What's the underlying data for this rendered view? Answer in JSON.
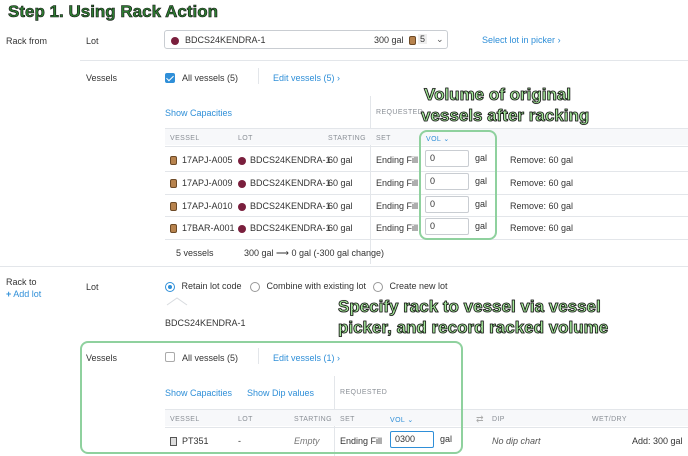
{
  "step_title": "Step 1.  Using Rack Action",
  "annotations": {
    "volume_line1": "Volume of original",
    "volume_line2": "vessels after racking",
    "specify_line1": "Specify rack to vessel via vessel",
    "specify_line2": "picker, and record racked volume"
  },
  "rack_from": {
    "label": "Rack from",
    "lot_label": "Lot",
    "lot_value": "BDCS24KENDRA-1",
    "lot_volume": "300 gal",
    "lot_count": "5",
    "select_lot_link": "Select lot in picker",
    "vessels_label": "Vessels",
    "all_vessels_label": "All vessels (5)",
    "edit_vessels_link": "Edit vessels (5)",
    "show_capacities": "Show Capacities",
    "requested_header": "REQUESTED",
    "columns": {
      "vessel": "VESSEL",
      "lot": "LOT",
      "starting": "STARTING",
      "set": "SET",
      "vol": "VOL"
    },
    "rows": [
      {
        "vessel": "17APJ-A005",
        "lot": "BDCS24KENDRA-1",
        "starting": "60 gal",
        "set": "Ending Fill",
        "vol": "0",
        "unit": "gal",
        "remove": "Remove: 60 gal"
      },
      {
        "vessel": "17APJ-A009",
        "lot": "BDCS24KENDRA-1",
        "starting": "60 gal",
        "set": "Ending Fill",
        "vol": "0",
        "unit": "gal",
        "remove": "Remove: 60 gal"
      },
      {
        "vessel": "17APJ-A010",
        "lot": "BDCS24KENDRA-1",
        "starting": "60 gal",
        "set": "Ending Fill",
        "vol": "0",
        "unit": "gal",
        "remove": "Remove: 60 gal"
      },
      {
        "vessel": "17BAR-A001",
        "lot": "BDCS24KENDRA-1",
        "starting": "60 gal",
        "set": "Ending Fill",
        "vol": "0",
        "unit": "gal",
        "remove": "Remove: 60 gal"
      }
    ],
    "footer_count": "5 vessels",
    "footer_from": "300 gal",
    "footer_to": "0 gal (-300 gal change)"
  },
  "rack_to": {
    "label": "Rack to",
    "add_lot": "Add lot",
    "lot_label": "Lot",
    "option_retain": "Retain lot code",
    "option_combine": "Combine with existing lot",
    "option_create": "Create new lot",
    "lot_code": "BDCS24KENDRA-1",
    "vessels_label": "Vessels",
    "all_vessels_label": "All vessels (5)",
    "edit_vessels_link": "Edit vessels (1)",
    "show_capacities": "Show Capacities",
    "show_dip_values": "Show Dip values",
    "requested_header": "REQUESTED",
    "columns": {
      "vessel": "VESSEL",
      "lot": "LOT",
      "starting": "STARTING",
      "set": "SET",
      "vol": "VOL",
      "dip": "DIP",
      "wetdry": "WET/DRY"
    },
    "row": {
      "vessel": "PT351",
      "lot": "-",
      "starting": "Empty",
      "set": "Ending Fill",
      "vol": "0300",
      "unit": "gal",
      "dip": "No dip chart",
      "add": "Add: 300 gal"
    }
  },
  "colors": {
    "accent": "#2f8fd8",
    "lot_swatch": "#7a1f3d",
    "annotation_box": "#8fd19e",
    "title_green": "#2e7d32"
  }
}
